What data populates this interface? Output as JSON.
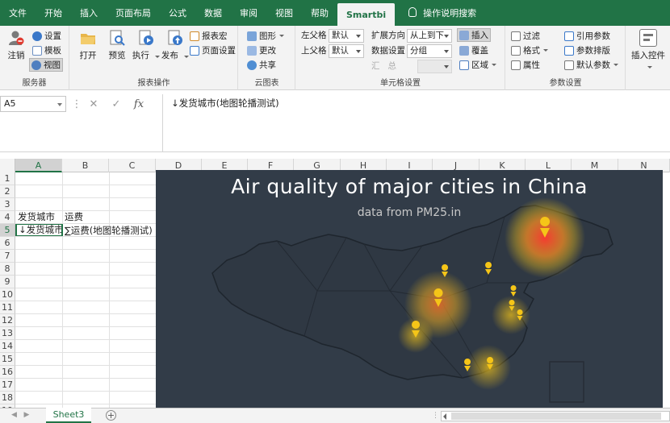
{
  "tabs": [
    {
      "label": "文件",
      "active": false
    },
    {
      "label": "开始",
      "active": false
    },
    {
      "label": "插入",
      "active": false
    },
    {
      "label": "页面布局",
      "active": false
    },
    {
      "label": "公式",
      "active": false
    },
    {
      "label": "数据",
      "active": false
    },
    {
      "label": "审阅",
      "active": false
    },
    {
      "label": "视图",
      "active": false
    },
    {
      "label": "帮助",
      "active": false
    },
    {
      "label": "Smartbi",
      "active": true
    }
  ],
  "search": {
    "label": "操作说明搜索"
  },
  "ribbon": {
    "server": {
      "group_label": "服务器",
      "logout": "注销",
      "settings": "设置",
      "template": "模板",
      "view": "视图"
    },
    "report_ops": {
      "group_label": "报表操作",
      "open": "打开",
      "preview": "预览",
      "execute": "执行",
      "publish": "发布",
      "report_macro": "报表宏",
      "page_setup": "页面设置"
    },
    "cloud_chart": {
      "group_label": "云图表",
      "shape": "图形",
      "change": "更改",
      "share": "共享"
    },
    "cell_settings": {
      "group_label": "单元格设置",
      "left_parent_label": "左父格",
      "left_parent_value": "默认",
      "top_parent_label": "上父格",
      "top_parent_value": "默认",
      "expand_dir_label": "扩展方向",
      "expand_dir_value": "从上到下",
      "data_setting_label": "数据设置",
      "data_setting_value": "分组",
      "summary_label": "汇",
      "summary_label2": "总",
      "insert": "插入",
      "cover": "覆盖",
      "region": "区域"
    },
    "param_settings": {
      "group_label": "参数设置",
      "filter": "过滤",
      "format": "格式",
      "property": "属性",
      "ref_param": "引用参数",
      "param_layout": "参数排版",
      "default_param": "默认参数"
    },
    "insert_control": {
      "label": "插入控件"
    }
  },
  "formula_bar": {
    "name_box": "A5",
    "content": "↓发货城市(地图轮播测试)"
  },
  "columns": [
    "A",
    "B",
    "C",
    "D",
    "E",
    "F",
    "G",
    "H",
    "I",
    "J",
    "K",
    "L",
    "M",
    "N"
  ],
  "rows": [
    "1",
    "2",
    "3",
    "4",
    "5",
    "6",
    "7",
    "8",
    "9",
    "10",
    "11",
    "12",
    "13",
    "14",
    "15",
    "16",
    "17",
    "18",
    "19"
  ],
  "cells": {
    "A4": "发货城市",
    "B4": "运费",
    "A5": "↓发货城市(地图轮播测试)",
    "B5": "∑运费(地图轮播测试)"
  },
  "chart": {
    "title": "Air quality of major cities in China",
    "subtitle": "data from PM25.in",
    "background": "#323c48",
    "hot_color": "#e8412b",
    "warm_color": "#f5c518"
  },
  "sheets": [
    {
      "label": "Sheet3",
      "active": true
    }
  ],
  "colors": {
    "accent": "#217346"
  }
}
